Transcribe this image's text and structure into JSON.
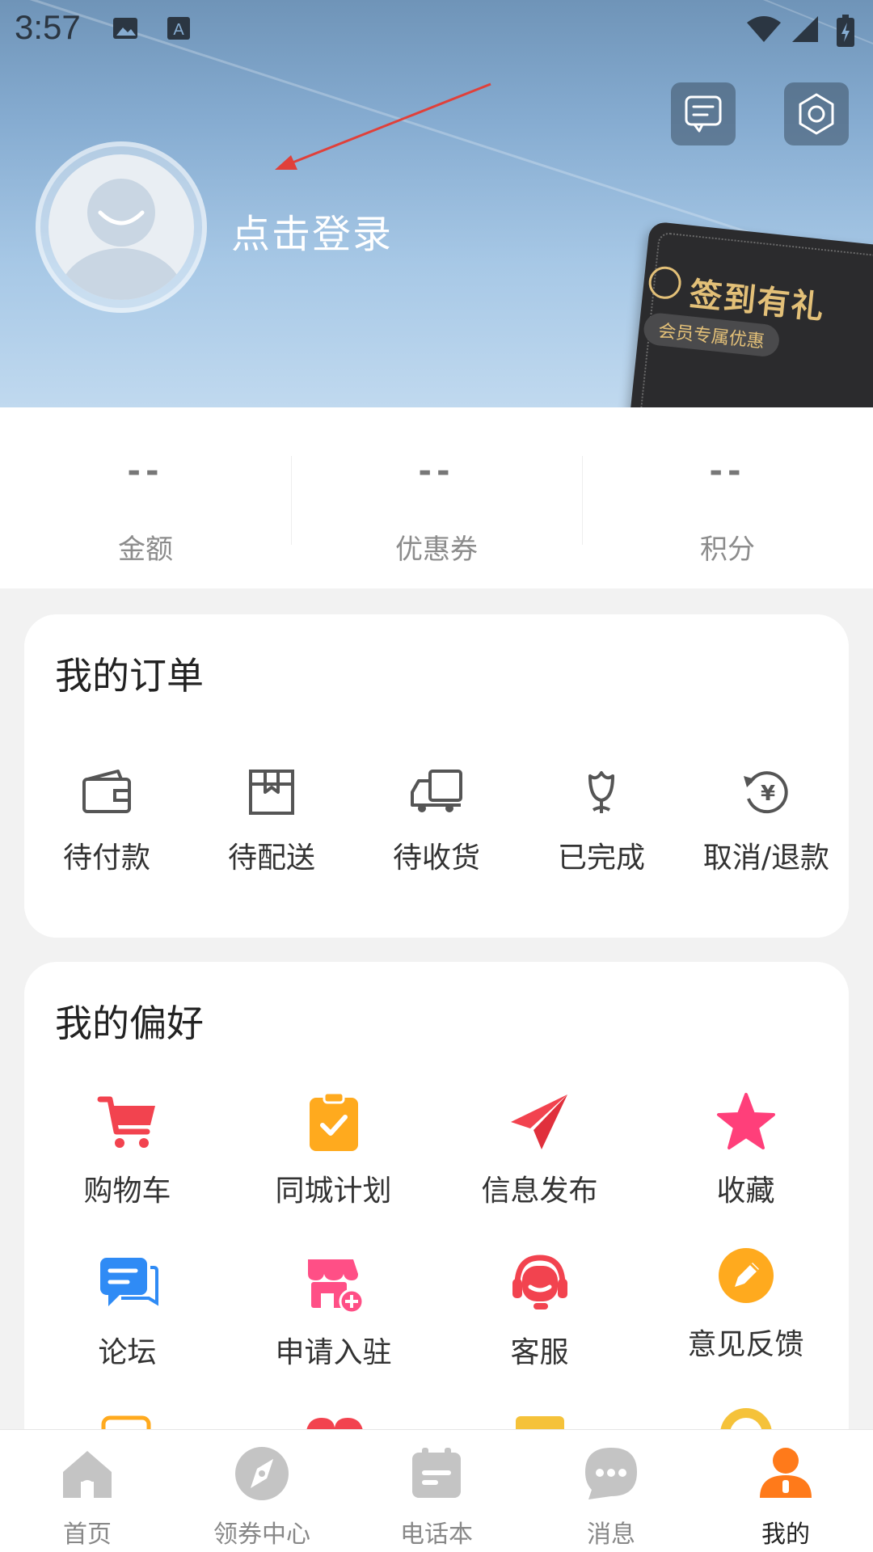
{
  "status_bar": {
    "time": "3:57"
  },
  "header": {
    "login_text": "点击登录",
    "vip_card": {
      "title": "签到有礼",
      "subtitle": "会员专属优惠"
    }
  },
  "stats": [
    {
      "value": "--",
      "label": "金额"
    },
    {
      "value": "--",
      "label": "优惠券"
    },
    {
      "value": "--",
      "label": "积分"
    }
  ],
  "orders": {
    "title": "我的订单",
    "items": [
      {
        "label": "待付款",
        "icon": "wallet-icon"
      },
      {
        "label": "待配送",
        "icon": "box-icon"
      },
      {
        "label": "待收货",
        "icon": "truck-icon"
      },
      {
        "label": "已完成",
        "icon": "flower-icon"
      },
      {
        "label": "取消/退款",
        "icon": "refund-icon"
      }
    ]
  },
  "prefs": {
    "title": "我的偏好",
    "items": [
      {
        "label": "购物车",
        "icon": "cart-icon",
        "color": "#f2434f"
      },
      {
        "label": "同城计划",
        "icon": "clipboard-icon",
        "color": "#ffaa1e"
      },
      {
        "label": "信息发布",
        "icon": "paper-plane-icon",
        "color": "#f2434f"
      },
      {
        "label": "收藏",
        "icon": "star-icon",
        "color": "#ff3f7a"
      },
      {
        "label": "论坛",
        "icon": "chat-icon",
        "color": "#2f8bf5"
      },
      {
        "label": "申请入驻",
        "icon": "store-icon",
        "color": "#ff4f86"
      },
      {
        "label": "客服",
        "icon": "headset-icon",
        "color": "#f2434f"
      },
      {
        "label": "意见反馈",
        "icon": "pencil-icon",
        "color": "#ffaa1e"
      }
    ]
  },
  "bottom_nav": {
    "items": [
      {
        "label": "首页",
        "icon": "home-icon"
      },
      {
        "label": "领券中心",
        "icon": "compass-icon"
      },
      {
        "label": "电话本",
        "icon": "phonebook-icon"
      },
      {
        "label": "消息",
        "icon": "message-icon"
      },
      {
        "label": "我的",
        "icon": "profile-icon",
        "active": true
      }
    ],
    "inactive_color": "#c4c4c4",
    "active_color": "#ff7a1a"
  }
}
